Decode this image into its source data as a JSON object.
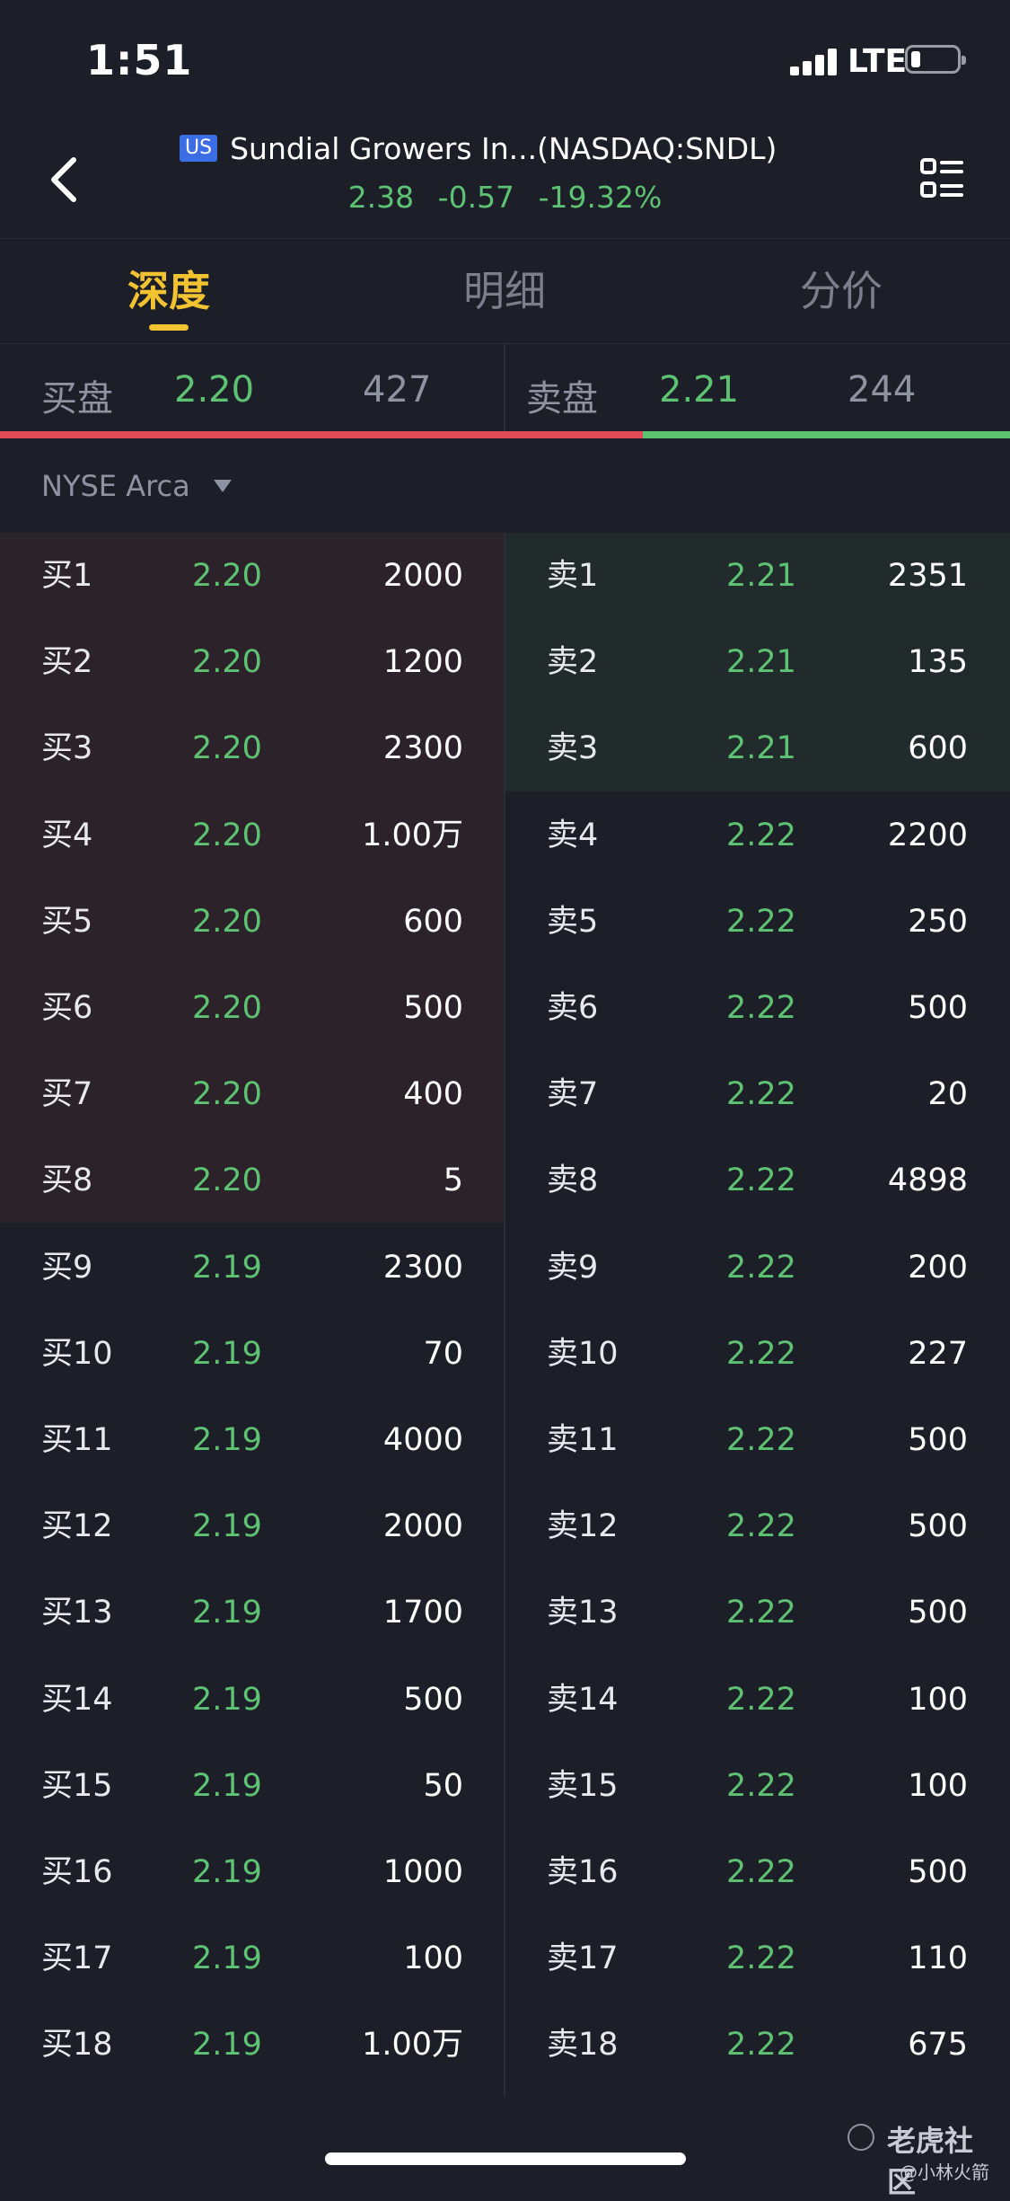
{
  "status_bar": {
    "time": "1:51",
    "network": "LTE",
    "battery_level": 0.2
  },
  "header": {
    "badge": "US",
    "title": "Sundial Growers In...(NASDAQ:SNDL)",
    "price": "2.38",
    "change": "-0.57",
    "change_pct": "-19.32%",
    "back_icon": "chevron-left-icon",
    "menu_icon": "list-menu-icon"
  },
  "tabs": [
    {
      "label": "深度",
      "active": true
    },
    {
      "label": "明细",
      "active": false
    },
    {
      "label": "分价",
      "active": false
    }
  ],
  "summary": {
    "bid_label": "买盘",
    "bid_price": "2.20",
    "bid_qty": "427",
    "ask_label": "卖盘",
    "ask_price": "2.21",
    "ask_qty": "244",
    "bid_ratio": 0.636
  },
  "exchange": {
    "selected": "NYSE Arca"
  },
  "order_book": {
    "bids": [
      {
        "label": "买1",
        "price": "2.20",
        "qty": "2000"
      },
      {
        "label": "买2",
        "price": "2.20",
        "qty": "1200"
      },
      {
        "label": "买3",
        "price": "2.20",
        "qty": "2300"
      },
      {
        "label": "买4",
        "price": "2.20",
        "qty": "1.00万"
      },
      {
        "label": "买5",
        "price": "2.20",
        "qty": "600"
      },
      {
        "label": "买6",
        "price": "2.20",
        "qty": "500"
      },
      {
        "label": "买7",
        "price": "2.20",
        "qty": "400"
      },
      {
        "label": "买8",
        "price": "2.20",
        "qty": "5"
      },
      {
        "label": "买9",
        "price": "2.19",
        "qty": "2300"
      },
      {
        "label": "买10",
        "price": "2.19",
        "qty": "70"
      },
      {
        "label": "买11",
        "price": "2.19",
        "qty": "4000"
      },
      {
        "label": "买12",
        "price": "2.19",
        "qty": "2000"
      },
      {
        "label": "买13",
        "price": "2.19",
        "qty": "1700"
      },
      {
        "label": "买14",
        "price": "2.19",
        "qty": "500"
      },
      {
        "label": "买15",
        "price": "2.19",
        "qty": "50"
      },
      {
        "label": "买16",
        "price": "2.19",
        "qty": "1000"
      },
      {
        "label": "买17",
        "price": "2.19",
        "qty": "100"
      },
      {
        "label": "买18",
        "price": "2.19",
        "qty": "1.00万"
      }
    ],
    "asks": [
      {
        "label": "卖1",
        "price": "2.21",
        "qty": "2351"
      },
      {
        "label": "卖2",
        "price": "2.21",
        "qty": "135"
      },
      {
        "label": "卖3",
        "price": "2.21",
        "qty": "600"
      },
      {
        "label": "卖4",
        "price": "2.22",
        "qty": "2200"
      },
      {
        "label": "卖5",
        "price": "2.22",
        "qty": "250"
      },
      {
        "label": "卖6",
        "price": "2.22",
        "qty": "500"
      },
      {
        "label": "卖7",
        "price": "2.22",
        "qty": "20"
      },
      {
        "label": "卖8",
        "price": "2.22",
        "qty": "4898"
      },
      {
        "label": "卖9",
        "price": "2.22",
        "qty": "200"
      },
      {
        "label": "卖10",
        "price": "2.22",
        "qty": "227"
      },
      {
        "label": "卖11",
        "price": "2.22",
        "qty": "500"
      },
      {
        "label": "卖12",
        "price": "2.22",
        "qty": "500"
      },
      {
        "label": "卖13",
        "price": "2.22",
        "qty": "500"
      },
      {
        "label": "卖14",
        "price": "2.22",
        "qty": "100"
      },
      {
        "label": "卖15",
        "price": "2.22",
        "qty": "100"
      },
      {
        "label": "卖16",
        "price": "2.22",
        "qty": "500"
      },
      {
        "label": "卖17",
        "price": "2.22",
        "qty": "110"
      },
      {
        "label": "卖18",
        "price": "2.22",
        "qty": "675"
      }
    ]
  },
  "watermark": {
    "name": "老虎社区",
    "user": "@小林火箭"
  },
  "colors": {
    "up": "#5ec273",
    "down": "#e04b57",
    "accent": "#f2c230",
    "background": "#1c1e28"
  }
}
